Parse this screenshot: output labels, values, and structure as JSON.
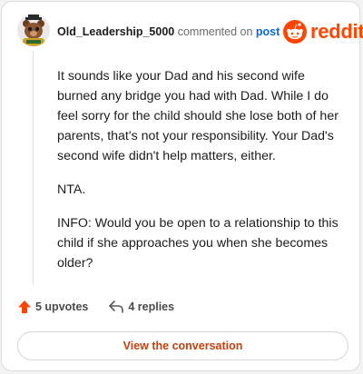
{
  "comment": {
    "username": "Old_Leadership_5000",
    "action": "commented on",
    "target": "post",
    "paragraphs": [
      "It sounds like your Dad and his second wife burned any bridge you had with Dad. While I do feel sorry for the child should she lose both of her parents, that's not your responsibility. Your Dad's second wife didn't help matters, either.",
      "NTA.",
      "INFO: Would you be open to a relationship to this child if she approaches you when she becomes older?"
    ]
  },
  "brand": {
    "name": "reddit",
    "color": "#ff4500"
  },
  "footer": {
    "upvotes": "5 upvotes",
    "replies": "4 replies",
    "upvote_icon": "upvote-arrow-icon",
    "reply_icon": "reply-arrow-icon"
  },
  "cta": {
    "label": "View the conversation"
  },
  "colors": {
    "accent": "#ff4500",
    "link": "#0b66d6",
    "cta_text": "#c4400c"
  }
}
